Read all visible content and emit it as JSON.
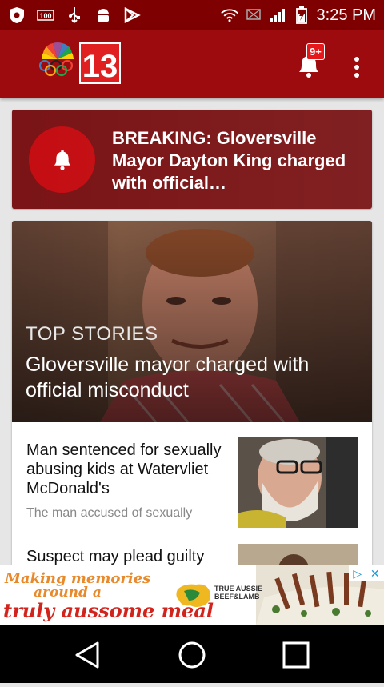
{
  "status_bar": {
    "time": "3:25 PM",
    "icons": [
      "shield-icon",
      "notification-100-icon",
      "usb-icon",
      "android-icon",
      "play-store-icon",
      "wifi-icon",
      "no-sim-icon",
      "signal-icon",
      "battery-icon"
    ]
  },
  "app_bar": {
    "logo_channel": "13",
    "notification_badge": "9+",
    "icons": [
      "nbc-peacock-logo",
      "bell-icon",
      "more-vert-icon"
    ]
  },
  "breaking": {
    "text": "BREAKING: Gloversville Mayor Dayton King charged with official…",
    "icon": "bell-icon"
  },
  "top_story": {
    "section": "TOP STORIES",
    "title": "Gloversville mayor charged with official misconduct"
  },
  "stories": [
    {
      "title": "Man sentenced for sexually abusing kids at Watervliet McDonald's",
      "summary": "The man accused of sexually"
    },
    {
      "title": "Suspect may plead guilty",
      "summary": ""
    }
  ],
  "ad": {
    "line1": "Making memories",
    "line2": "around a",
    "line3": "truly aussome meal",
    "brand": "TRUE AUSSIE BEEF&LAMB",
    "colors": {
      "orange": "#e88a2b",
      "red": "#d2241d"
    }
  },
  "colors": {
    "status_bar": "#7e0000",
    "app_bar": "#9e0b0f",
    "breaking_bg": "#7a1416",
    "breaking_circle": "#c40d12"
  }
}
